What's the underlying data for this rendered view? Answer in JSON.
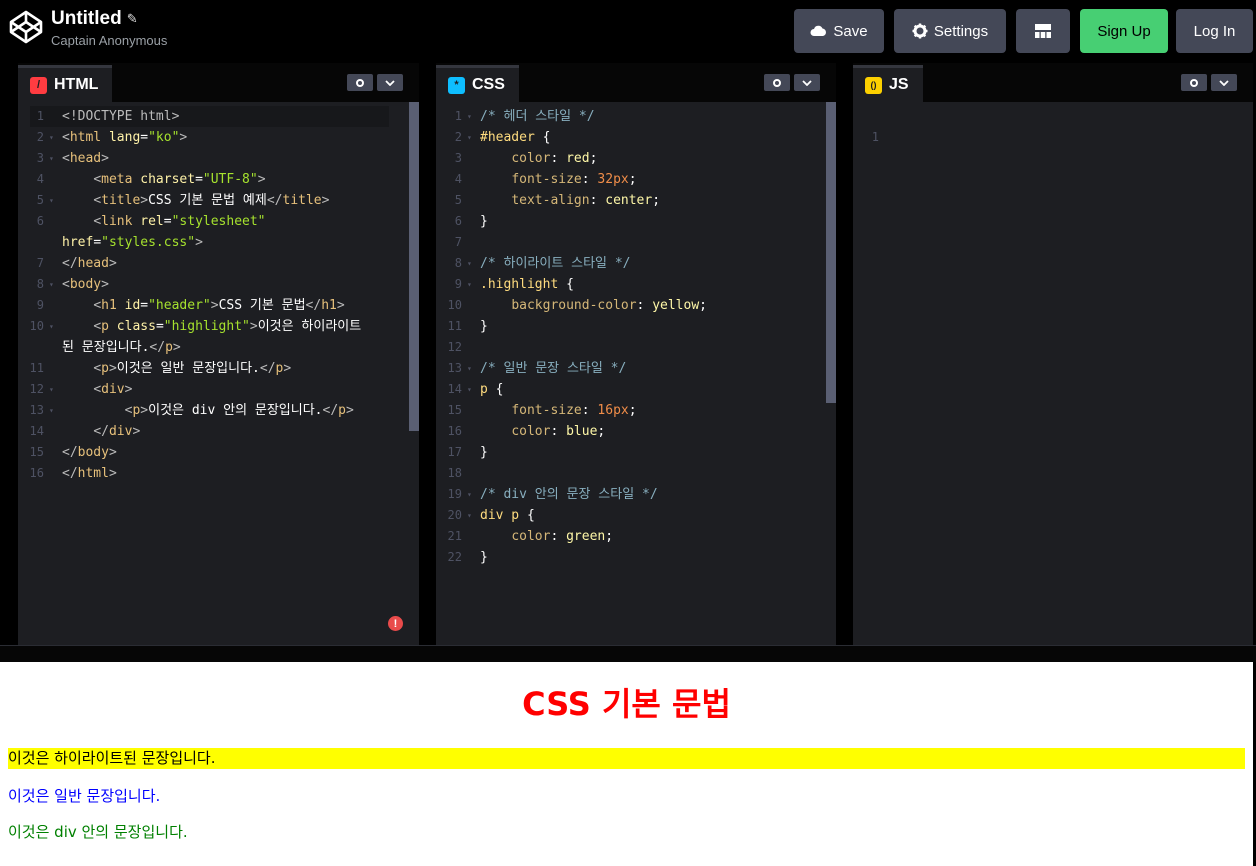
{
  "header": {
    "title": "Untitled",
    "author": "Captain Anonymous",
    "buttons": {
      "save": "Save",
      "settings": "Settings",
      "signup": "Sign Up",
      "login": "Log In"
    }
  },
  "editors": {
    "html": {
      "label": "HTML",
      "icon_glyph": "/",
      "icon_color": "#ff3c41"
    },
    "css": {
      "label": "CSS",
      "icon_glyph": "*",
      "icon_color": "#0ebeff"
    },
    "js": {
      "label": "JS",
      "icon_glyph": "()",
      "icon_color": "#fcd000",
      "line_numbers": [
        "1"
      ]
    }
  },
  "html_code": [
    {
      "n": "1",
      "fold": "",
      "parts": [
        [
          "t-tag",
          "<!DOCTYPE html>"
        ]
      ]
    },
    {
      "n": "2",
      "fold": "▾",
      "parts": [
        [
          "t-tag",
          "<"
        ],
        [
          "t-name",
          "html"
        ],
        [
          "t-attr",
          " lang"
        ],
        [
          "t-punct",
          "="
        ],
        [
          "t-str",
          "\"ko\""
        ],
        [
          "t-tag",
          ">"
        ]
      ]
    },
    {
      "n": "3",
      "fold": "▾",
      "parts": [
        [
          "t-tag",
          "<"
        ],
        [
          "t-name",
          "head"
        ],
        [
          "t-tag",
          ">"
        ]
      ]
    },
    {
      "n": "4",
      "fold": "",
      "parts": [
        [
          "t-punct",
          "    "
        ],
        [
          "t-tag",
          "<"
        ],
        [
          "t-name",
          "meta"
        ],
        [
          "t-attr",
          " charset"
        ],
        [
          "t-punct",
          "="
        ],
        [
          "t-str",
          "\"UTF-8\""
        ],
        [
          "t-tag",
          ">"
        ]
      ]
    },
    {
      "n": "5",
      "fold": "▾",
      "parts": [
        [
          "t-punct",
          "    "
        ],
        [
          "t-tag",
          "<"
        ],
        [
          "t-name",
          "title"
        ],
        [
          "t-tag",
          ">"
        ],
        [
          "t-punct",
          "CSS 기본 문법 예제"
        ],
        [
          "t-tag",
          "</"
        ],
        [
          "t-name",
          "title"
        ],
        [
          "t-tag",
          ">"
        ]
      ]
    },
    {
      "n": "6",
      "fold": "",
      "parts": [
        [
          "t-punct",
          "    "
        ],
        [
          "t-tag",
          "<"
        ],
        [
          "t-name",
          "link"
        ],
        [
          "t-attr",
          " rel"
        ],
        [
          "t-punct",
          "="
        ],
        [
          "t-str",
          "\"stylesheet\""
        ]
      ]
    },
    {
      "n": "",
      "fold": "",
      "parts": [
        [
          "t-attr",
          "href"
        ],
        [
          "t-punct",
          "="
        ],
        [
          "t-str",
          "\"styles.css\""
        ],
        [
          "t-tag",
          ">"
        ]
      ]
    },
    {
      "n": "7",
      "fold": "",
      "parts": [
        [
          "t-tag",
          "</"
        ],
        [
          "t-name",
          "head"
        ],
        [
          "t-tag",
          ">"
        ]
      ]
    },
    {
      "n": "8",
      "fold": "▾",
      "parts": [
        [
          "t-tag",
          "<"
        ],
        [
          "t-name",
          "body"
        ],
        [
          "t-tag",
          ">"
        ]
      ]
    },
    {
      "n": "9",
      "fold": "",
      "parts": [
        [
          "t-punct",
          "    "
        ],
        [
          "t-tag",
          "<"
        ],
        [
          "t-name",
          "h1"
        ],
        [
          "t-attr",
          " id"
        ],
        [
          "t-punct",
          "="
        ],
        [
          "t-str",
          "\"header\""
        ],
        [
          "t-tag",
          ">"
        ],
        [
          "t-punct",
          "CSS 기본 문법"
        ],
        [
          "t-tag",
          "</"
        ],
        [
          "t-name",
          "h1"
        ],
        [
          "t-tag",
          ">"
        ]
      ]
    },
    {
      "n": "10",
      "fold": "▾",
      "parts": [
        [
          "t-punct",
          "    "
        ],
        [
          "t-tag",
          "<"
        ],
        [
          "t-name",
          "p"
        ],
        [
          "t-attr",
          " class"
        ],
        [
          "t-punct",
          "="
        ],
        [
          "t-str",
          "\"highlight\""
        ],
        [
          "t-tag",
          ">"
        ],
        [
          "t-punct",
          "이것은 하이라이트"
        ]
      ]
    },
    {
      "n": "",
      "fold": "",
      "parts": [
        [
          "t-punct",
          "된 문장입니다."
        ],
        [
          "t-tag",
          "</"
        ],
        [
          "t-name",
          "p"
        ],
        [
          "t-tag",
          ">"
        ]
      ]
    },
    {
      "n": "11",
      "fold": "",
      "parts": [
        [
          "t-punct",
          "    "
        ],
        [
          "t-tag",
          "<"
        ],
        [
          "t-name",
          "p"
        ],
        [
          "t-tag",
          ">"
        ],
        [
          "t-punct",
          "이것은 일반 문장입니다."
        ],
        [
          "t-tag",
          "</"
        ],
        [
          "t-name",
          "p"
        ],
        [
          "t-tag",
          ">"
        ]
      ]
    },
    {
      "n": "12",
      "fold": "▾",
      "parts": [
        [
          "t-punct",
          "    "
        ],
        [
          "t-tag",
          "<"
        ],
        [
          "t-name",
          "div"
        ],
        [
          "t-tag",
          ">"
        ]
      ]
    },
    {
      "n": "13",
      "fold": "▾",
      "parts": [
        [
          "t-punct",
          "        "
        ],
        [
          "t-tag",
          "<"
        ],
        [
          "t-name",
          "p"
        ],
        [
          "t-tag",
          ">"
        ],
        [
          "t-punct",
          "이것은 div 안의 문장입니다."
        ],
        [
          "t-tag",
          "</"
        ],
        [
          "t-name",
          "p"
        ],
        [
          "t-tag",
          ">"
        ]
      ]
    },
    {
      "n": "14",
      "fold": "",
      "parts": [
        [
          "t-punct",
          "    "
        ],
        [
          "t-tag",
          "</"
        ],
        [
          "t-name",
          "div"
        ],
        [
          "t-tag",
          ">"
        ]
      ]
    },
    {
      "n": "15",
      "fold": "",
      "parts": [
        [
          "t-tag",
          "</"
        ],
        [
          "t-name",
          "body"
        ],
        [
          "t-tag",
          ">"
        ]
      ]
    },
    {
      "n": "16",
      "fold": "",
      "parts": [
        [
          "t-tag",
          "</"
        ],
        [
          "t-name",
          "html"
        ],
        [
          "t-tag",
          ">"
        ]
      ]
    }
  ],
  "css_code": [
    {
      "n": "1",
      "fold": "▾",
      "parts": [
        [
          "t-com",
          "/* 헤더 스타일 */"
        ]
      ]
    },
    {
      "n": "2",
      "fold": "▾",
      "parts": [
        [
          "t-sel",
          "#header"
        ],
        [
          "t-punct",
          " {"
        ]
      ]
    },
    {
      "n": "3",
      "fold": "",
      "parts": [
        [
          "t-punct",
          "    "
        ],
        [
          "t-prop",
          "color"
        ],
        [
          "t-punct",
          ": "
        ],
        [
          "t-val",
          "red"
        ],
        [
          "t-punct",
          ";"
        ]
      ]
    },
    {
      "n": "4",
      "fold": "",
      "parts": [
        [
          "t-punct",
          "    "
        ],
        [
          "t-prop",
          "font-size"
        ],
        [
          "t-punct",
          ": "
        ],
        [
          "t-num",
          "32px"
        ],
        [
          "t-punct",
          ";"
        ]
      ]
    },
    {
      "n": "5",
      "fold": "",
      "parts": [
        [
          "t-punct",
          "    "
        ],
        [
          "t-prop",
          "text-align"
        ],
        [
          "t-punct",
          ": "
        ],
        [
          "t-val",
          "center"
        ],
        [
          "t-punct",
          ";"
        ]
      ]
    },
    {
      "n": "6",
      "fold": "",
      "parts": [
        [
          "t-punct",
          "}"
        ]
      ]
    },
    {
      "n": "7",
      "fold": "",
      "parts": []
    },
    {
      "n": "8",
      "fold": "▾",
      "parts": [
        [
          "t-com",
          "/* 하이라이트 스타일 */"
        ]
      ]
    },
    {
      "n": "9",
      "fold": "▾",
      "parts": [
        [
          "t-sel",
          ".highlight"
        ],
        [
          "t-punct",
          " {"
        ]
      ]
    },
    {
      "n": "10",
      "fold": "",
      "parts": [
        [
          "t-punct",
          "    "
        ],
        [
          "t-prop",
          "background-color"
        ],
        [
          "t-punct",
          ": "
        ],
        [
          "t-val",
          "yellow"
        ],
        [
          "t-punct",
          ";"
        ]
      ]
    },
    {
      "n": "11",
      "fold": "",
      "parts": [
        [
          "t-punct",
          "}"
        ]
      ]
    },
    {
      "n": "12",
      "fold": "",
      "parts": []
    },
    {
      "n": "13",
      "fold": "▾",
      "parts": [
        [
          "t-com",
          "/* 일반 문장 스타일 */"
        ]
      ]
    },
    {
      "n": "14",
      "fold": "▾",
      "parts": [
        [
          "t-sel",
          "p"
        ],
        [
          "t-punct",
          " {"
        ]
      ]
    },
    {
      "n": "15",
      "fold": "",
      "parts": [
        [
          "t-punct",
          "    "
        ],
        [
          "t-prop",
          "font-size"
        ],
        [
          "t-punct",
          ": "
        ],
        [
          "t-num",
          "16px"
        ],
        [
          "t-punct",
          ";"
        ]
      ]
    },
    {
      "n": "16",
      "fold": "",
      "parts": [
        [
          "t-punct",
          "    "
        ],
        [
          "t-prop",
          "color"
        ],
        [
          "t-punct",
          ": "
        ],
        [
          "t-val",
          "blue"
        ],
        [
          "t-punct",
          ";"
        ]
      ]
    },
    {
      "n": "17",
      "fold": "",
      "parts": [
        [
          "t-punct",
          "}"
        ]
      ]
    },
    {
      "n": "18",
      "fold": "",
      "parts": []
    },
    {
      "n": "19",
      "fold": "▾",
      "parts": [
        [
          "t-com",
          "/* div 안의 문장 스타일 */"
        ]
      ]
    },
    {
      "n": "20",
      "fold": "▾",
      "parts": [
        [
          "t-sel",
          "div p"
        ],
        [
          "t-punct",
          " {"
        ]
      ]
    },
    {
      "n": "21",
      "fold": "",
      "parts": [
        [
          "t-punct",
          "    "
        ],
        [
          "t-prop",
          "color"
        ],
        [
          "t-punct",
          ": "
        ],
        [
          "t-val",
          "green"
        ],
        [
          "t-punct",
          ";"
        ]
      ]
    },
    {
      "n": "22",
      "fold": "",
      "parts": [
        [
          "t-punct",
          "}"
        ]
      ]
    }
  ],
  "preview": {
    "h1": "CSS 기본 문법",
    "highlight": "이것은 하이라이트된 문장입니다.",
    "p_normal": "이것은 일반 문장입니다.",
    "p_div": "이것은 div 안의 문장입니다."
  },
  "status": {
    "error_icon": "!"
  }
}
